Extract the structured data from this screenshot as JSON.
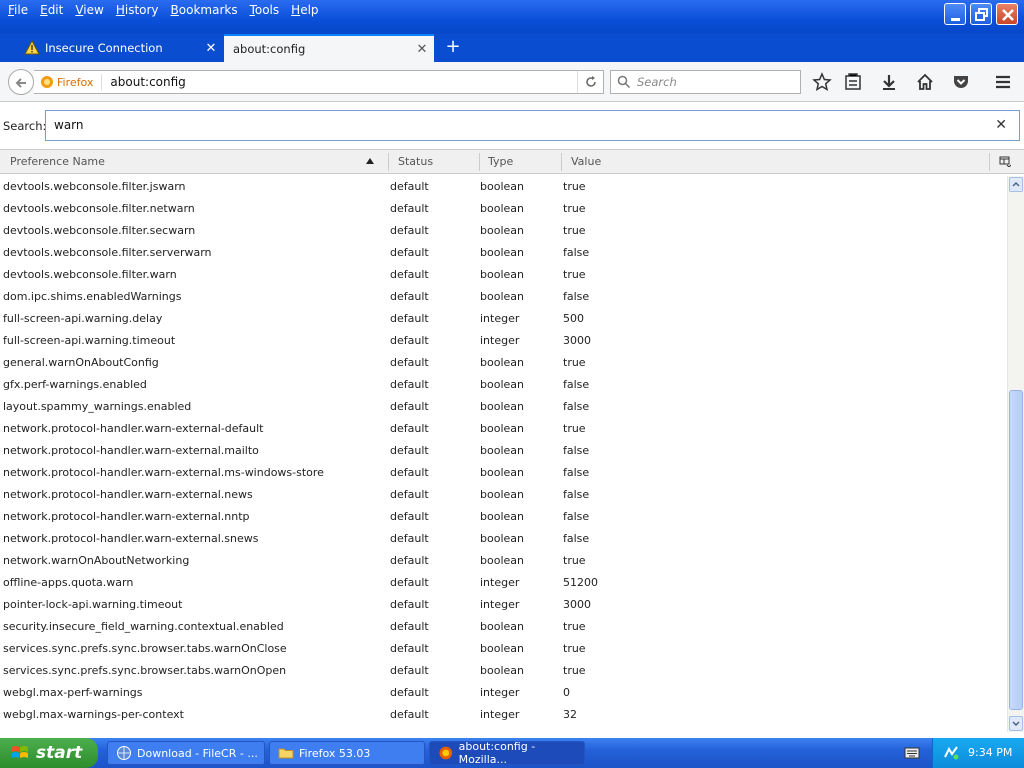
{
  "menu": [
    {
      "label": "File",
      "ul": "F",
      "rest": "ile"
    },
    {
      "label": "Edit",
      "ul": "E",
      "rest": "dit"
    },
    {
      "label": "View",
      "ul": "V",
      "rest": "iew"
    },
    {
      "label": "History",
      "ul": "H",
      "rest": "istory"
    },
    {
      "label": "Bookmarks",
      "ul": "B",
      "rest": "ookmarks"
    },
    {
      "label": "Tools",
      "ul": "T",
      "rest": "ools"
    },
    {
      "label": "Help",
      "ul": "H",
      "rest": "elp"
    }
  ],
  "tabs": [
    {
      "label": "Insecure Connection"
    },
    {
      "label": "about:config"
    }
  ],
  "new_tab_label": "+",
  "nav": {
    "identity_label": "Firefox",
    "url": "about:config",
    "search_placeholder": "Search"
  },
  "filter": {
    "label": "Search:",
    "value": "warn"
  },
  "columns": {
    "name": "Preference Name",
    "status": "Status",
    "type": "Type",
    "value": "Value"
  },
  "rows": [
    {
      "name": "devtools.webconsole.filter.jswarn",
      "status": "default",
      "type": "boolean",
      "value": "true"
    },
    {
      "name": "devtools.webconsole.filter.netwarn",
      "status": "default",
      "type": "boolean",
      "value": "true"
    },
    {
      "name": "devtools.webconsole.filter.secwarn",
      "status": "default",
      "type": "boolean",
      "value": "true"
    },
    {
      "name": "devtools.webconsole.filter.serverwarn",
      "status": "default",
      "type": "boolean",
      "value": "false"
    },
    {
      "name": "devtools.webconsole.filter.warn",
      "status": "default",
      "type": "boolean",
      "value": "true"
    },
    {
      "name": "dom.ipc.shims.enabledWarnings",
      "status": "default",
      "type": "boolean",
      "value": "false"
    },
    {
      "name": "full-screen-api.warning.delay",
      "status": "default",
      "type": "integer",
      "value": "500"
    },
    {
      "name": "full-screen-api.warning.timeout",
      "status": "default",
      "type": "integer",
      "value": "3000"
    },
    {
      "name": "general.warnOnAboutConfig",
      "status": "default",
      "type": "boolean",
      "value": "true"
    },
    {
      "name": "gfx.perf-warnings.enabled",
      "status": "default",
      "type": "boolean",
      "value": "false"
    },
    {
      "name": "layout.spammy_warnings.enabled",
      "status": "default",
      "type": "boolean",
      "value": "false"
    },
    {
      "name": "network.protocol-handler.warn-external-default",
      "status": "default",
      "type": "boolean",
      "value": "true"
    },
    {
      "name": "network.protocol-handler.warn-external.mailto",
      "status": "default",
      "type": "boolean",
      "value": "false"
    },
    {
      "name": "network.protocol-handler.warn-external.ms-windows-store",
      "status": "default",
      "type": "boolean",
      "value": "false"
    },
    {
      "name": "network.protocol-handler.warn-external.news",
      "status": "default",
      "type": "boolean",
      "value": "false"
    },
    {
      "name": "network.protocol-handler.warn-external.nntp",
      "status": "default",
      "type": "boolean",
      "value": "false"
    },
    {
      "name": "network.protocol-handler.warn-external.snews",
      "status": "default",
      "type": "boolean",
      "value": "false"
    },
    {
      "name": "network.warnOnAboutNetworking",
      "status": "default",
      "type": "boolean",
      "value": "true"
    },
    {
      "name": "offline-apps.quota.warn",
      "status": "default",
      "type": "integer",
      "value": "51200"
    },
    {
      "name": "pointer-lock-api.warning.timeout",
      "status": "default",
      "type": "integer",
      "value": "3000"
    },
    {
      "name": "security.insecure_field_warning.contextual.enabled",
      "status": "default",
      "type": "boolean",
      "value": "true"
    },
    {
      "name": "services.sync.prefs.sync.browser.tabs.warnOnClose",
      "status": "default",
      "type": "boolean",
      "value": "true"
    },
    {
      "name": "services.sync.prefs.sync.browser.tabs.warnOnOpen",
      "status": "default",
      "type": "boolean",
      "value": "true"
    },
    {
      "name": "webgl.max-perf-warnings",
      "status": "default",
      "type": "integer",
      "value": "0"
    },
    {
      "name": "webgl.max-warnings-per-context",
      "status": "default",
      "type": "integer",
      "value": "32"
    }
  ],
  "taskbar": {
    "start_label": "start",
    "tasks": [
      {
        "label": "Download - FileCR - ...",
        "icon": "globe-icon"
      },
      {
        "label": "Firefox 53.03",
        "icon": "folder-icon"
      },
      {
        "label": "about:config - Mozilla...",
        "icon": "firefox-icon"
      }
    ],
    "clock": "9:34 PM"
  },
  "colors": {
    "titlebar": "#0a4fd8",
    "accent": "#0a84ff",
    "identity": "#d76e00"
  }
}
